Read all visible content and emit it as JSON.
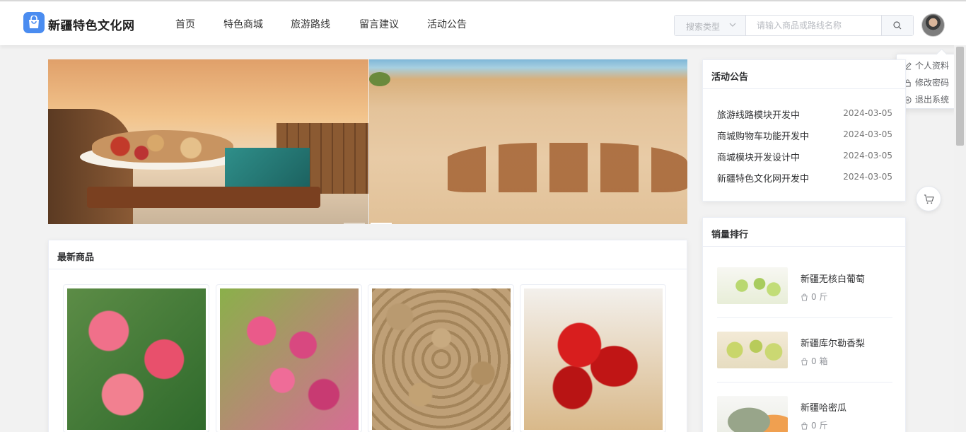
{
  "header": {
    "site_name": "新疆特色文化网",
    "nav": [
      "首页",
      "特色商城",
      "旅游路线",
      "留言建议",
      "活动公告"
    ],
    "search": {
      "type_label": "搜索类型",
      "placeholder": "请输入商品或路线名称"
    }
  },
  "user_menu": {
    "items": [
      "个人资料",
      "修改密码",
      "退出系统"
    ]
  },
  "banner": {
    "slide_count": 2,
    "active_slide": 2
  },
  "latest_products": {
    "title": "最新商品",
    "products": [
      {
        "image": "red apples"
      },
      {
        "image": "red grapes"
      },
      {
        "image": "walnuts"
      },
      {
        "image": "red jujubes"
      }
    ]
  },
  "announcements": {
    "title": "活动公告",
    "items": [
      {
        "title": "旅游线路模块开发中",
        "date": "2024-03-05"
      },
      {
        "title": "商城购物车功能开发中",
        "date": "2024-03-05"
      },
      {
        "title": "商城模块开发设计中",
        "date": "2024-03-05"
      },
      {
        "title": "新疆特色文化网开发中",
        "date": "2024-03-05"
      }
    ]
  },
  "sales_ranking": {
    "title": "销量排行",
    "items": [
      {
        "name": "新疆无核白葡萄",
        "sales": "0 斤"
      },
      {
        "name": "新疆库尔勒香梨",
        "sales": "0 箱"
      },
      {
        "name": "新疆哈密瓜",
        "sales": "0 斤"
      }
    ]
  },
  "colors": {
    "brand": "#4a8cf0",
    "text": "#303133",
    "muted": "#909399"
  },
  "icons": [
    "bag-logo-icon",
    "chevron-down-icon",
    "search-icon",
    "edit-icon",
    "lock-icon",
    "close-circle-icon",
    "cart-icon",
    "bag-icon"
  ]
}
